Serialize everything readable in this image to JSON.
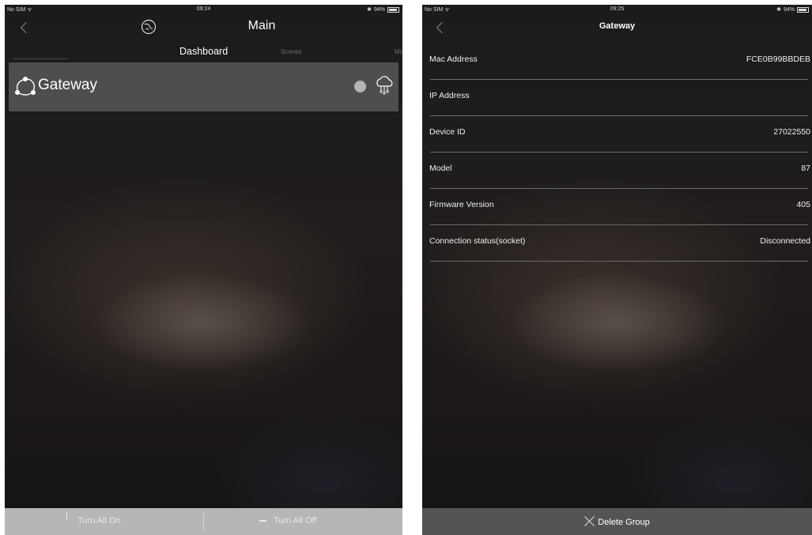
{
  "left_screen": {
    "status": {
      "carrier": "No SIM",
      "time": "09:24",
      "battery": "94%"
    },
    "nav": {
      "title": "Main"
    },
    "tabs": [
      "Dashboard",
      "Scenes",
      "Mo"
    ],
    "gateway_card": {
      "title": "Gateway"
    },
    "bottom": {
      "turn_on": "Turn All On",
      "turn_off": "Turn All Off"
    }
  },
  "right_screen": {
    "status": {
      "carrier": "No SIM",
      "time": "09:25",
      "battery": "94%"
    },
    "nav": {
      "title": "Gateway"
    },
    "rows": [
      {
        "label": "Mac Address",
        "value": "FCE0B99BBDEB"
      },
      {
        "label": "IP Address",
        "value": ""
      },
      {
        "label": "Device ID",
        "value": "27022550"
      },
      {
        "label": "Model",
        "value": "87"
      },
      {
        "label": "Firmware Version",
        "value": "405"
      },
      {
        "label": "Connection status(socket)",
        "value": "Disconnected"
      }
    ],
    "delete_label": "Delete Group"
  },
  "colors": {
    "card": "#7a7777",
    "bottom_bar": "#b7b6b6",
    "delete_bar": "#555353"
  }
}
